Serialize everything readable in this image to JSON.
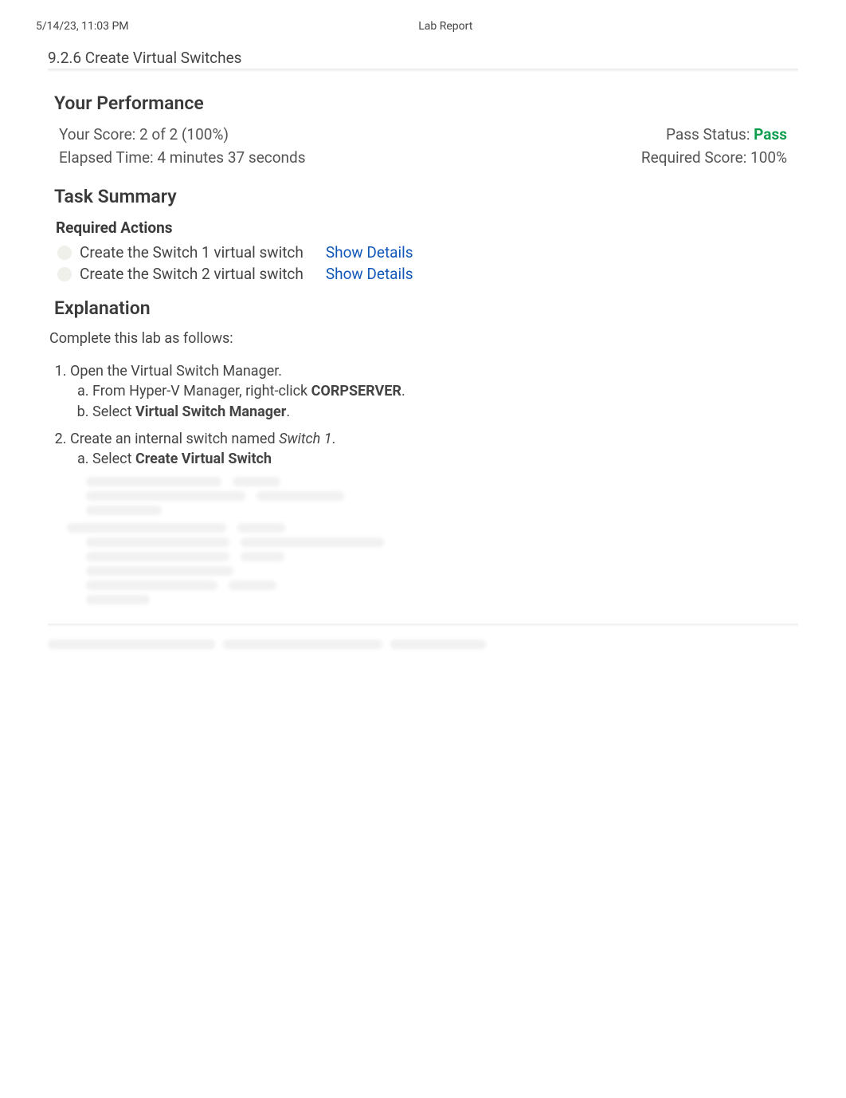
{
  "header": {
    "timestamp": "5/14/23, 11:03 PM",
    "doc_title": "Lab Report"
  },
  "title": "9.2.6 Create Virtual Switches",
  "performance": {
    "heading": "Your Performance",
    "score_label": "Your Score: ",
    "score_value": "2 of 2 (100%)",
    "pass_label": "Pass Status: ",
    "pass_value": "Pass",
    "elapsed_label": "Elapsed Time: ",
    "elapsed_value": "4 minutes 37 seconds",
    "required_label": "Required Score: ",
    "required_value": "100%"
  },
  "task_summary": {
    "heading": "Task Summary",
    "required_heading": "Required Actions",
    "actions": [
      {
        "text": "Create the Switch 1 virtual switch",
        "link": "Show Details"
      },
      {
        "text": "Create the Switch 2 virtual switch",
        "link": "Show Details"
      }
    ]
  },
  "explanation": {
    "heading": "Explanation",
    "intro": "Complete this lab as follows:",
    "step1": {
      "text": "Open the Virtual Switch Manager.",
      "a_pre": "From Hyper-V Manager, right-click ",
      "a_bold": "CORPSERVER",
      "a_post": ".",
      "b_pre": "Select ",
      "b_bold": "Virtual Switch Manager",
      "b_post": "."
    },
    "step2": {
      "pre": "Create an internal switch named ",
      "italic": "Switch 1",
      "post": ".",
      "a_pre": "Select ",
      "a_bold": "Create Virtual Switch"
    }
  }
}
